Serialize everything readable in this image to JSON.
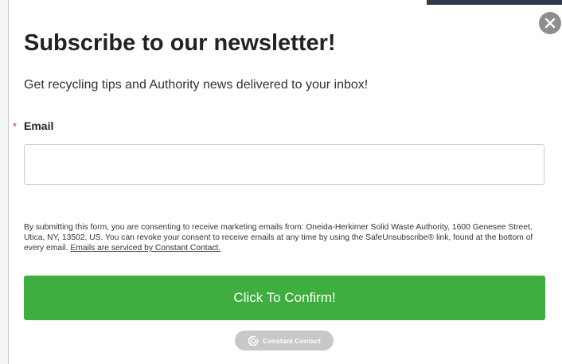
{
  "form": {
    "title": "Subscribe to our newsletter!",
    "subtitle": "Get recycling tips and Authority news delivered to your inbox!",
    "required_marker": "*",
    "email_label": "Email",
    "email_value": "",
    "email_placeholder": "",
    "consent_text": "By submitting this form, you are consenting to receive marketing emails from: Oneida-Herkimer Solid Waste Authority, 1600 Genesee Street, Utica, NY, 13502, US. You can revoke your consent to receive emails at any time by using the SafeUnsubscribe® link, found at the bottom of every email.",
    "consent_link": "Emails are serviced by Constant Contact.",
    "submit_label": "Click To Confirm!",
    "badge_label": "Constant Contact"
  },
  "colors": {
    "submit_button": "#3eaf3e",
    "close_button": "#8e8e8e",
    "required_star": "#d83333",
    "badge": "#c8c8c8"
  },
  "icons": {
    "close": "close-icon",
    "badge": "constant-contact-logo-icon"
  }
}
